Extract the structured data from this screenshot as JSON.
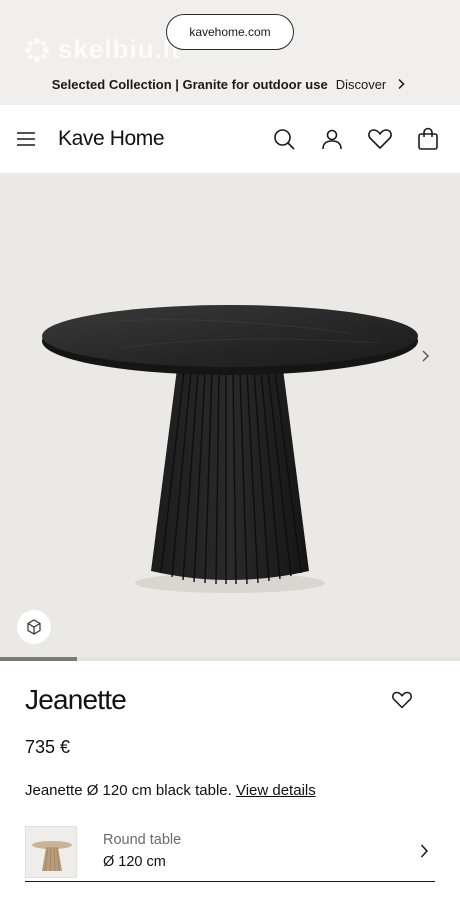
{
  "browser": {
    "url": "kavehome.com"
  },
  "watermark": {
    "text": "skelbiu.lt"
  },
  "promo": {
    "text": "Selected Collection | Granite for outdoor use",
    "link": "Discover"
  },
  "header": {
    "logo": "Kave Home",
    "icons": [
      "menu-icon",
      "search-icon",
      "user-icon",
      "heart-icon",
      "bag-icon"
    ]
  },
  "gallery": {
    "progress": 0.167,
    "icons": [
      "chevron-right-icon",
      "view-3d-icon"
    ]
  },
  "product": {
    "name": "Jeanette",
    "price": "735 €",
    "description": "Jeanette Ø 120 cm black table.",
    "details_link": "View details"
  },
  "variant": {
    "type": "Round table",
    "size": "Ø 120 cm"
  }
}
